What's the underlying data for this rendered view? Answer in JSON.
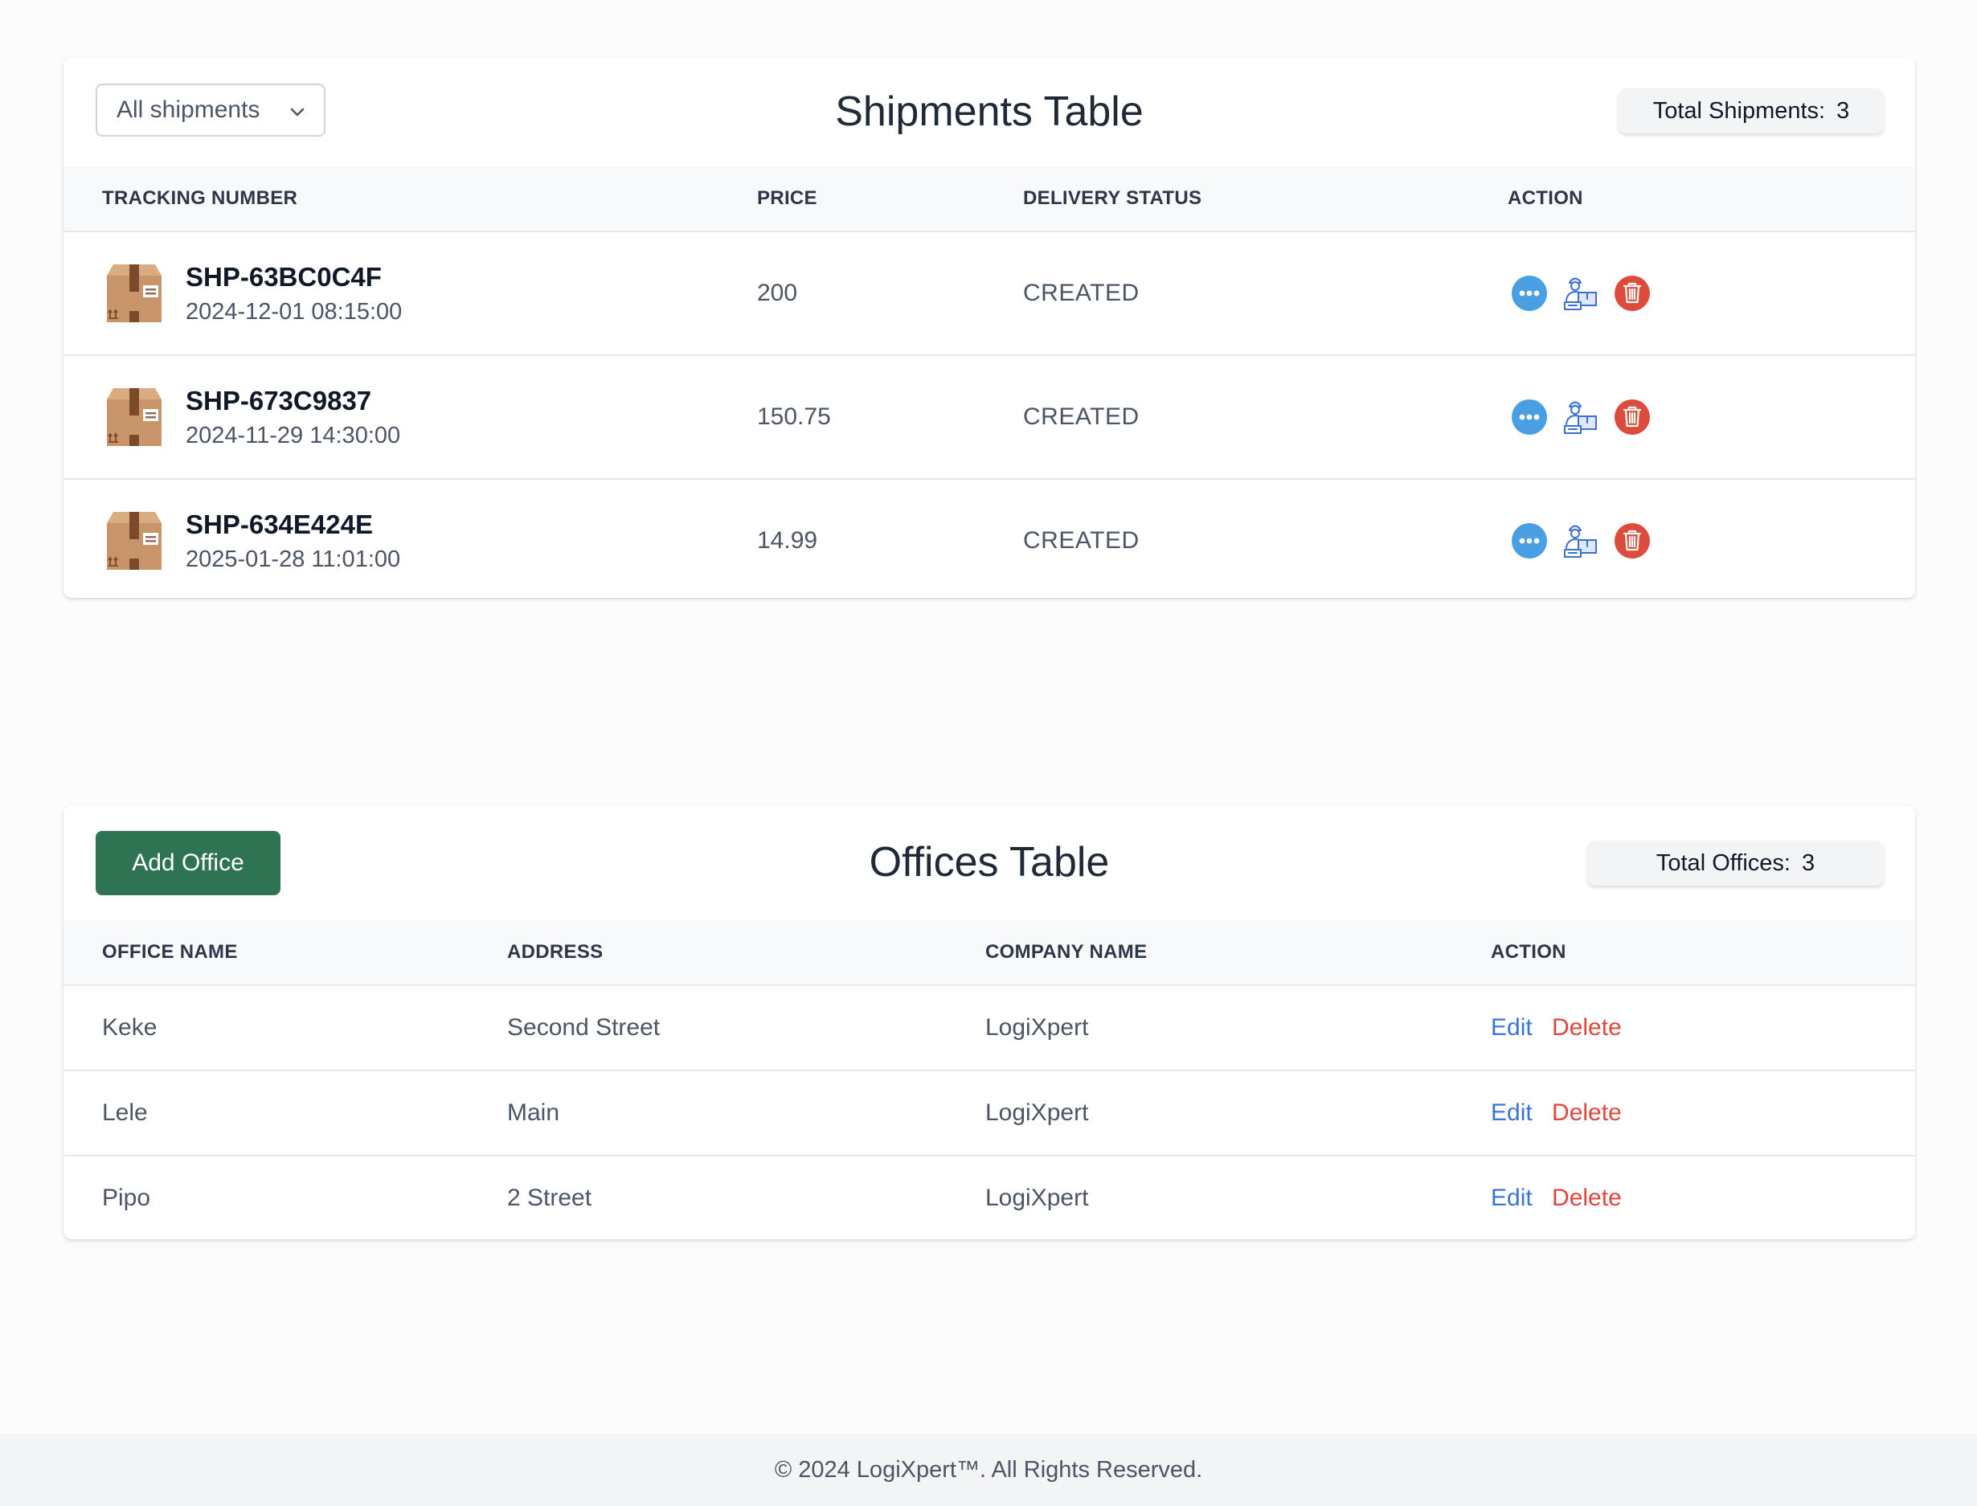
{
  "shipments": {
    "title": "Shipments Table",
    "filter": {
      "selected": "All shipments"
    },
    "total_label": "Total Shipments:",
    "total_value": "3",
    "columns": [
      "TRACKING NUMBER",
      "PRICE",
      "DELIVERY STATUS",
      "ACTION"
    ],
    "rows": [
      {
        "tracking": "SHP-63BC0C4F",
        "date": "2024-12-01 08:15:00",
        "price": "200",
        "status": "CREATED"
      },
      {
        "tracking": "SHP-673C9837",
        "date": "2024-11-29 14:30:00",
        "price": "150.75",
        "status": "CREATED"
      },
      {
        "tracking": "SHP-634E424E",
        "date": "2025-01-28 11:01:00",
        "price": "14.99",
        "status": "CREATED"
      }
    ],
    "action_icons": [
      "more-options-icon",
      "courier-assign-icon",
      "trash-icon"
    ]
  },
  "offices": {
    "title": "Offices Table",
    "add_button": "Add Office",
    "total_label": "Total Offices:",
    "total_value": "3",
    "columns": [
      "OFFICE NAME",
      "ADDRESS",
      "COMPANY NAME",
      "ACTION"
    ],
    "rows": [
      {
        "name": "Keke",
        "address": "Second Street",
        "company": "LogiXpert",
        "edit": "Edit",
        "delete": "Delete"
      },
      {
        "name": "Lele",
        "address": "Main",
        "company": "LogiXpert",
        "edit": "Edit",
        "delete": "Delete"
      },
      {
        "name": "Pipo",
        "address": "2 Street",
        "company": "LogiXpert",
        "edit": "Edit",
        "delete": "Delete"
      }
    ]
  },
  "footer": {
    "text": "© 2024 LogiXpert™. All Rights Reserved."
  },
  "colors": {
    "primary_button": "#2e7352",
    "edit_link": "#3b74d9",
    "delete_link": "#e0463a",
    "more_icon": "#4a9fe3",
    "trash_icon": "#dd4b3c"
  }
}
